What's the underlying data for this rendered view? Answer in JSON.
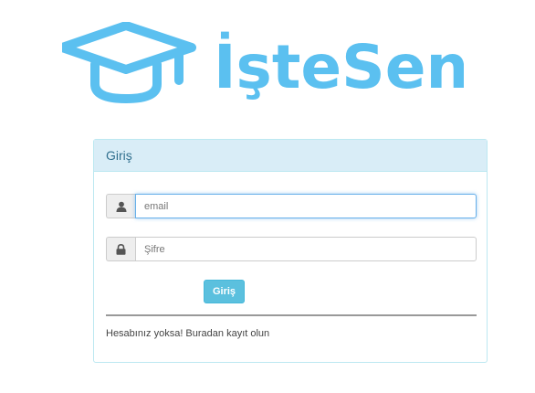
{
  "brand": {
    "name": "İşteSen",
    "color": "#5bc0f0"
  },
  "login_panel": {
    "title": "Giriş",
    "email_placeholder": "email",
    "password_placeholder": "Şifre",
    "submit_label": "Giriş",
    "register_text": "Hesabınız yoksa! Buradan kayıt olun",
    "icons": {
      "email": "user-icon",
      "password": "lock-icon"
    }
  },
  "colors": {
    "panel_heading_bg": "#d9edf7",
    "panel_border": "#bce8f1",
    "button_bg": "#5bc0de",
    "focus_border": "#66afe9"
  }
}
